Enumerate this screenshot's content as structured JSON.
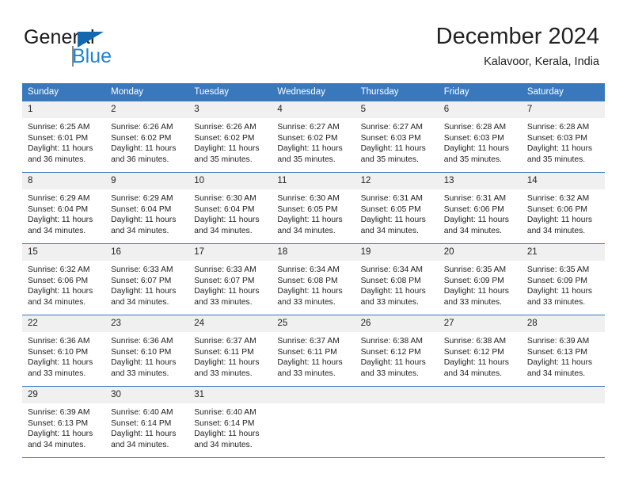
{
  "brand": {
    "name_part1": "General",
    "name_part2": "Blue",
    "flag_icon": "triangle-flag-icon"
  },
  "header": {
    "title": "December 2024",
    "subtitle": "Kalavoor, Kerala, India"
  },
  "colors": {
    "header_blue": "#3a78bd",
    "brand_blue": "#1f86d0",
    "flag_blue": "#1269b0",
    "daynum_band": "#f0f0f0",
    "text": "#222222"
  },
  "weekday_headers": [
    "Sunday",
    "Monday",
    "Tuesday",
    "Wednesday",
    "Thursday",
    "Friday",
    "Saturday"
  ],
  "labels": {
    "sunrise_prefix": "Sunrise:",
    "sunset_prefix": "Sunset:",
    "daylight_prefix": "Daylight:"
  },
  "weeks": [
    [
      {
        "day": "1",
        "sunrise": "Sunrise: 6:25 AM",
        "sunset": "Sunset: 6:01 PM",
        "daylight": "Daylight: 11 hours and 36 minutes."
      },
      {
        "day": "2",
        "sunrise": "Sunrise: 6:26 AM",
        "sunset": "Sunset: 6:02 PM",
        "daylight": "Daylight: 11 hours and 36 minutes."
      },
      {
        "day": "3",
        "sunrise": "Sunrise: 6:26 AM",
        "sunset": "Sunset: 6:02 PM",
        "daylight": "Daylight: 11 hours and 35 minutes."
      },
      {
        "day": "4",
        "sunrise": "Sunrise: 6:27 AM",
        "sunset": "Sunset: 6:02 PM",
        "daylight": "Daylight: 11 hours and 35 minutes."
      },
      {
        "day": "5",
        "sunrise": "Sunrise: 6:27 AM",
        "sunset": "Sunset: 6:03 PM",
        "daylight": "Daylight: 11 hours and 35 minutes."
      },
      {
        "day": "6",
        "sunrise": "Sunrise: 6:28 AM",
        "sunset": "Sunset: 6:03 PM",
        "daylight": "Daylight: 11 hours and 35 minutes."
      },
      {
        "day": "7",
        "sunrise": "Sunrise: 6:28 AM",
        "sunset": "Sunset: 6:03 PM",
        "daylight": "Daylight: 11 hours and 35 minutes."
      }
    ],
    [
      {
        "day": "8",
        "sunrise": "Sunrise: 6:29 AM",
        "sunset": "Sunset: 6:04 PM",
        "daylight": "Daylight: 11 hours and 34 minutes."
      },
      {
        "day": "9",
        "sunrise": "Sunrise: 6:29 AM",
        "sunset": "Sunset: 6:04 PM",
        "daylight": "Daylight: 11 hours and 34 minutes."
      },
      {
        "day": "10",
        "sunrise": "Sunrise: 6:30 AM",
        "sunset": "Sunset: 6:04 PM",
        "daylight": "Daylight: 11 hours and 34 minutes."
      },
      {
        "day": "11",
        "sunrise": "Sunrise: 6:30 AM",
        "sunset": "Sunset: 6:05 PM",
        "daylight": "Daylight: 11 hours and 34 minutes."
      },
      {
        "day": "12",
        "sunrise": "Sunrise: 6:31 AM",
        "sunset": "Sunset: 6:05 PM",
        "daylight": "Daylight: 11 hours and 34 minutes."
      },
      {
        "day": "13",
        "sunrise": "Sunrise: 6:31 AM",
        "sunset": "Sunset: 6:06 PM",
        "daylight": "Daylight: 11 hours and 34 minutes."
      },
      {
        "day": "14",
        "sunrise": "Sunrise: 6:32 AM",
        "sunset": "Sunset: 6:06 PM",
        "daylight": "Daylight: 11 hours and 34 minutes."
      }
    ],
    [
      {
        "day": "15",
        "sunrise": "Sunrise: 6:32 AM",
        "sunset": "Sunset: 6:06 PM",
        "daylight": "Daylight: 11 hours and 34 minutes."
      },
      {
        "day": "16",
        "sunrise": "Sunrise: 6:33 AM",
        "sunset": "Sunset: 6:07 PM",
        "daylight": "Daylight: 11 hours and 34 minutes."
      },
      {
        "day": "17",
        "sunrise": "Sunrise: 6:33 AM",
        "sunset": "Sunset: 6:07 PM",
        "daylight": "Daylight: 11 hours and 33 minutes."
      },
      {
        "day": "18",
        "sunrise": "Sunrise: 6:34 AM",
        "sunset": "Sunset: 6:08 PM",
        "daylight": "Daylight: 11 hours and 33 minutes."
      },
      {
        "day": "19",
        "sunrise": "Sunrise: 6:34 AM",
        "sunset": "Sunset: 6:08 PM",
        "daylight": "Daylight: 11 hours and 33 minutes."
      },
      {
        "day": "20",
        "sunrise": "Sunrise: 6:35 AM",
        "sunset": "Sunset: 6:09 PM",
        "daylight": "Daylight: 11 hours and 33 minutes."
      },
      {
        "day": "21",
        "sunrise": "Sunrise: 6:35 AM",
        "sunset": "Sunset: 6:09 PM",
        "daylight": "Daylight: 11 hours and 33 minutes."
      }
    ],
    [
      {
        "day": "22",
        "sunrise": "Sunrise: 6:36 AM",
        "sunset": "Sunset: 6:10 PM",
        "daylight": "Daylight: 11 hours and 33 minutes."
      },
      {
        "day": "23",
        "sunrise": "Sunrise: 6:36 AM",
        "sunset": "Sunset: 6:10 PM",
        "daylight": "Daylight: 11 hours and 33 minutes."
      },
      {
        "day": "24",
        "sunrise": "Sunrise: 6:37 AM",
        "sunset": "Sunset: 6:11 PM",
        "daylight": "Daylight: 11 hours and 33 minutes."
      },
      {
        "day": "25",
        "sunrise": "Sunrise: 6:37 AM",
        "sunset": "Sunset: 6:11 PM",
        "daylight": "Daylight: 11 hours and 33 minutes."
      },
      {
        "day": "26",
        "sunrise": "Sunrise: 6:38 AM",
        "sunset": "Sunset: 6:12 PM",
        "daylight": "Daylight: 11 hours and 33 minutes."
      },
      {
        "day": "27",
        "sunrise": "Sunrise: 6:38 AM",
        "sunset": "Sunset: 6:12 PM",
        "daylight": "Daylight: 11 hours and 34 minutes."
      },
      {
        "day": "28",
        "sunrise": "Sunrise: 6:39 AM",
        "sunset": "Sunset: 6:13 PM",
        "daylight": "Daylight: 11 hours and 34 minutes."
      }
    ],
    [
      {
        "day": "29",
        "sunrise": "Sunrise: 6:39 AM",
        "sunset": "Sunset: 6:13 PM",
        "daylight": "Daylight: 11 hours and 34 minutes."
      },
      {
        "day": "30",
        "sunrise": "Sunrise: 6:40 AM",
        "sunset": "Sunset: 6:14 PM",
        "daylight": "Daylight: 11 hours and 34 minutes."
      },
      {
        "day": "31",
        "sunrise": "Sunrise: 6:40 AM",
        "sunset": "Sunset: 6:14 PM",
        "daylight": "Daylight: 11 hours and 34 minutes."
      },
      {
        "day": "",
        "sunrise": "",
        "sunset": "",
        "daylight": ""
      },
      {
        "day": "",
        "sunrise": "",
        "sunset": "",
        "daylight": ""
      },
      {
        "day": "",
        "sunrise": "",
        "sunset": "",
        "daylight": ""
      },
      {
        "day": "",
        "sunrise": "",
        "sunset": "",
        "daylight": ""
      }
    ]
  ]
}
